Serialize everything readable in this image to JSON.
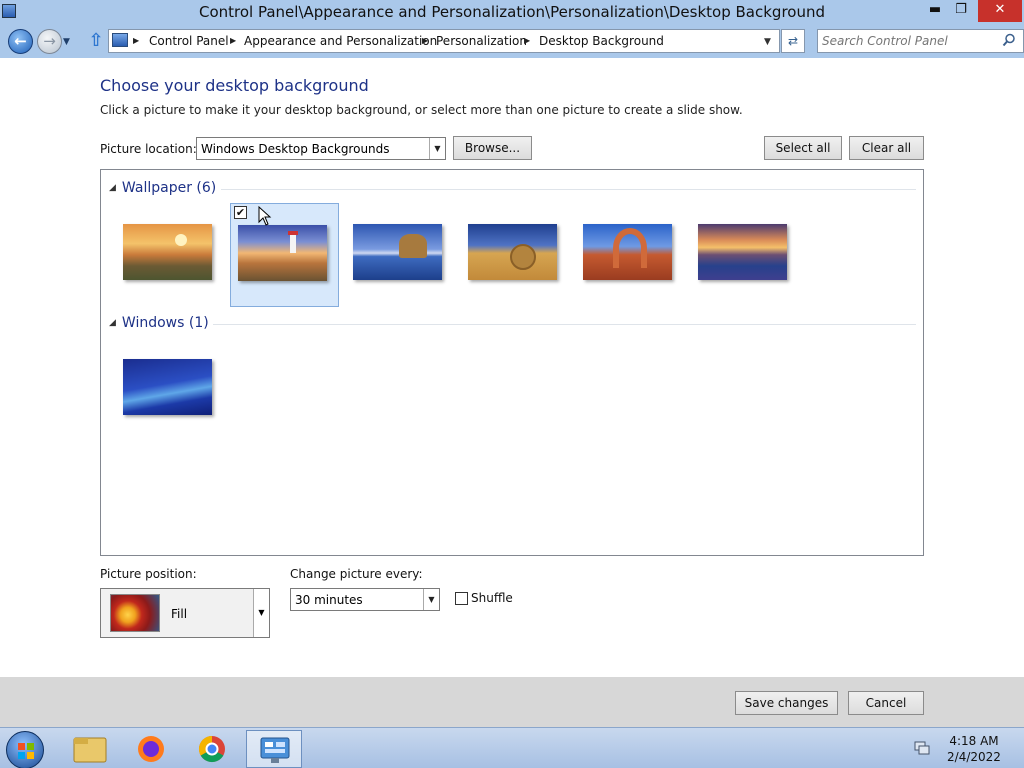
{
  "window": {
    "title": "Control Panel\\Appearance and Personalization\\Personalization\\Desktop Background",
    "min_glyph": "▬",
    "max_glyph": "❐",
    "close_glyph": "✕"
  },
  "nav": {
    "back_glyph": "←",
    "forward_glyph": "→",
    "history_glyph": "▼",
    "up_glyph": "⇧",
    "breadcrumbs": [
      "Control Panel",
      "Appearance and Personalization",
      "Personalization",
      "Desktop Background"
    ],
    "sep_glyph": "▶",
    "addr_dropdown_glyph": "▼",
    "refresh_glyph": "⇄",
    "search_placeholder": "Search Control Panel"
  },
  "content": {
    "title": "Choose your desktop background",
    "instructions": "Click a picture to make it your desktop background, or select more than one picture to create a slide show.",
    "picture_location_label": "Picture location:",
    "picture_location_value": "Windows Desktop Backgrounds",
    "browse_label": "Browse...",
    "select_all_label": "Select all",
    "clear_all_label": "Clear all",
    "dropdown_glyph": "▼",
    "groups": [
      {
        "name": "Wallpaper (6)",
        "items": [
          {
            "name": "sunset-fields",
            "checked": false
          },
          {
            "name": "lighthouse",
            "checked": true
          },
          {
            "name": "sea-rock",
            "checked": false
          },
          {
            "name": "hay-bale",
            "checked": false
          },
          {
            "name": "delicate-arch",
            "checked": false
          },
          {
            "name": "mountain-lake-flowers",
            "checked": false
          }
        ]
      },
      {
        "name": "Windows (1)",
        "items": [
          {
            "name": "windows-default",
            "checked": false
          }
        ]
      }
    ],
    "check_glyph": "✔",
    "group_triangle_glyph": "◢",
    "picture_position_label": "Picture position:",
    "picture_position_value": "Fill",
    "change_picture_label": "Change picture every:",
    "change_picture_value": "30 minutes",
    "shuffle_label": "Shuffle",
    "shuffle_checked": false,
    "save_label": "Save changes",
    "cancel_label": "Cancel"
  },
  "taskbar": {
    "time": "4:18 AM",
    "date": "2/4/2022",
    "items": [
      "file-explorer",
      "firefox",
      "chrome",
      "control-panel"
    ],
    "active_item": "control-panel"
  }
}
